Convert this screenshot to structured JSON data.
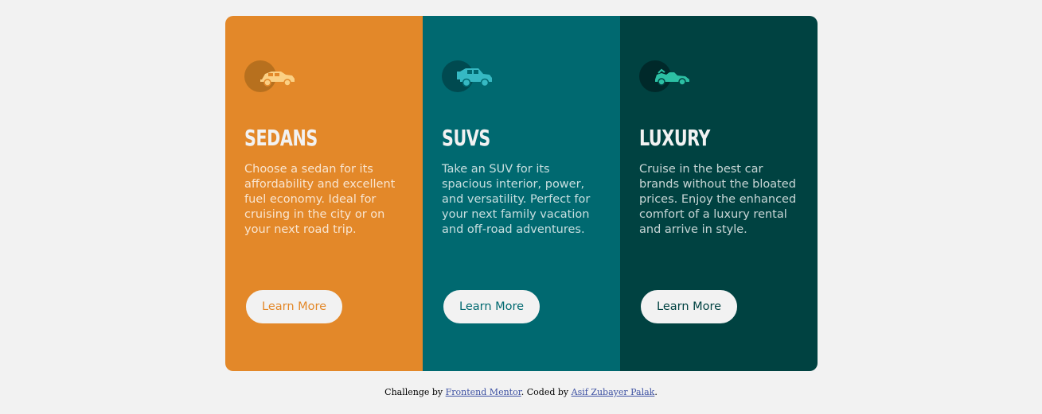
{
  "colors": {
    "page_background": "#f2f2f2",
    "sedans": "#e38829",
    "suvs": "#006970",
    "luxury": "#004241",
    "button_background": "#f2f2f2",
    "link": "#3e52a3"
  },
  "cards": [
    {
      "icon": "sedan-car-icon",
      "title": "SEDANS",
      "description": "Choose a sedan for its affordability and excellent fuel economy. Ideal for cruising in the city or on your next road trip.",
      "button_label": "Learn More",
      "background": "#e38829",
      "icon_color": "#fbd084",
      "icon_circle": "#b7701e"
    },
    {
      "icon": "suv-car-icon",
      "title": "SUVS",
      "description": "Take an SUV for its spacious interior, power, and versatility. Perfect for your next family vacation and off-road adventures.",
      "button_label": "Learn More",
      "background": "#006970",
      "icon_color": "#36b9c3",
      "icon_circle": "#004a50"
    },
    {
      "icon": "luxury-car-icon",
      "title": "LUXURY",
      "description": "Cruise in the best car brands without the bloated prices. Enjoy the enhanced comfort of a luxury rental and arrive in style.",
      "button_label": "Learn More",
      "background": "#004241",
      "icon_color": "#2cc0a4",
      "icon_circle": "#00292a"
    }
  ],
  "attribution": {
    "prefix": "Challenge by ",
    "challenge_link": "Frontend Mentor",
    "middle": ". Coded by ",
    "author_link": "Asif Zubayer Palak",
    "suffix": "."
  }
}
